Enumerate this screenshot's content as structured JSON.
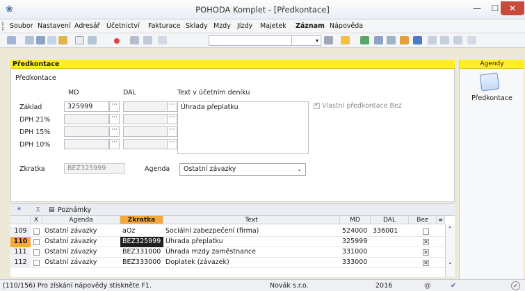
{
  "window": {
    "title": "POHODA Komplet - [Předkontace]"
  },
  "menu": [
    "Soubor",
    "Nastavení",
    "Adresář",
    "Účetnictví",
    "Fakturace",
    "Sklady",
    "Mzdy",
    "Jízdy",
    "Majetek",
    "Záznam",
    "Nápověda"
  ],
  "form": {
    "header": "Předkontace",
    "group_label": "Předkontace",
    "col_md": "MD",
    "col_dal": "DAL",
    "col_text": "Text v účetním deníku",
    "rows": [
      {
        "label": "Základ",
        "md": "325999"
      },
      {
        "label": "DPH 21%",
        "md": ""
      },
      {
        "label": "DPH 15%",
        "md": ""
      },
      {
        "label": "DPH 10%",
        "md": ""
      }
    ],
    "text_value": "Úhrada přeplatku",
    "checkbox_label": "Vlastní předkontace Bez",
    "zkratka_label": "Zkratka",
    "zkratka_value": "BEZ325999",
    "agenda_label": "Agenda",
    "agenda_value": "Ostatní závazky"
  },
  "agendy": {
    "header": "Agendy",
    "item": "Předkontace"
  },
  "tabs": {
    "tab1": "Poznámky"
  },
  "grid": {
    "columns": [
      "X",
      "Agenda",
      "Zkratka",
      "Text",
      "MD",
      "DAL",
      "Bez"
    ],
    "rows": [
      {
        "num": "109",
        "agenda": "Ostatní závazky",
        "zkratka": "aOz",
        "text": "Sociální zabezpečení (firma)",
        "md": "524000",
        "dal": "336001",
        "bez": false
      },
      {
        "num": "110",
        "agenda": "Ostatní závazky",
        "zkratka": "BEZ325999",
        "text": "Úhrada přeplatku",
        "md": "325999",
        "dal": "",
        "bez": true
      },
      {
        "num": "111",
        "agenda": "Ostatní závazky",
        "zkratka": "BEZ331000",
        "text": "Úhrada mzdy zaměstnance",
        "md": "331000",
        "dal": "",
        "bez": true
      },
      {
        "num": "112",
        "agenda": "Ostatní závazky",
        "zkratka": "BEZ333000",
        "text": "Doplatek (závazek)",
        "md": "333000",
        "dal": "",
        "bez": true
      }
    ]
  },
  "status": {
    "hint": "(110/156) Pro získání nápovědy stiskněte F1.",
    "company": "Novák s.r.o.",
    "year": "2016"
  }
}
